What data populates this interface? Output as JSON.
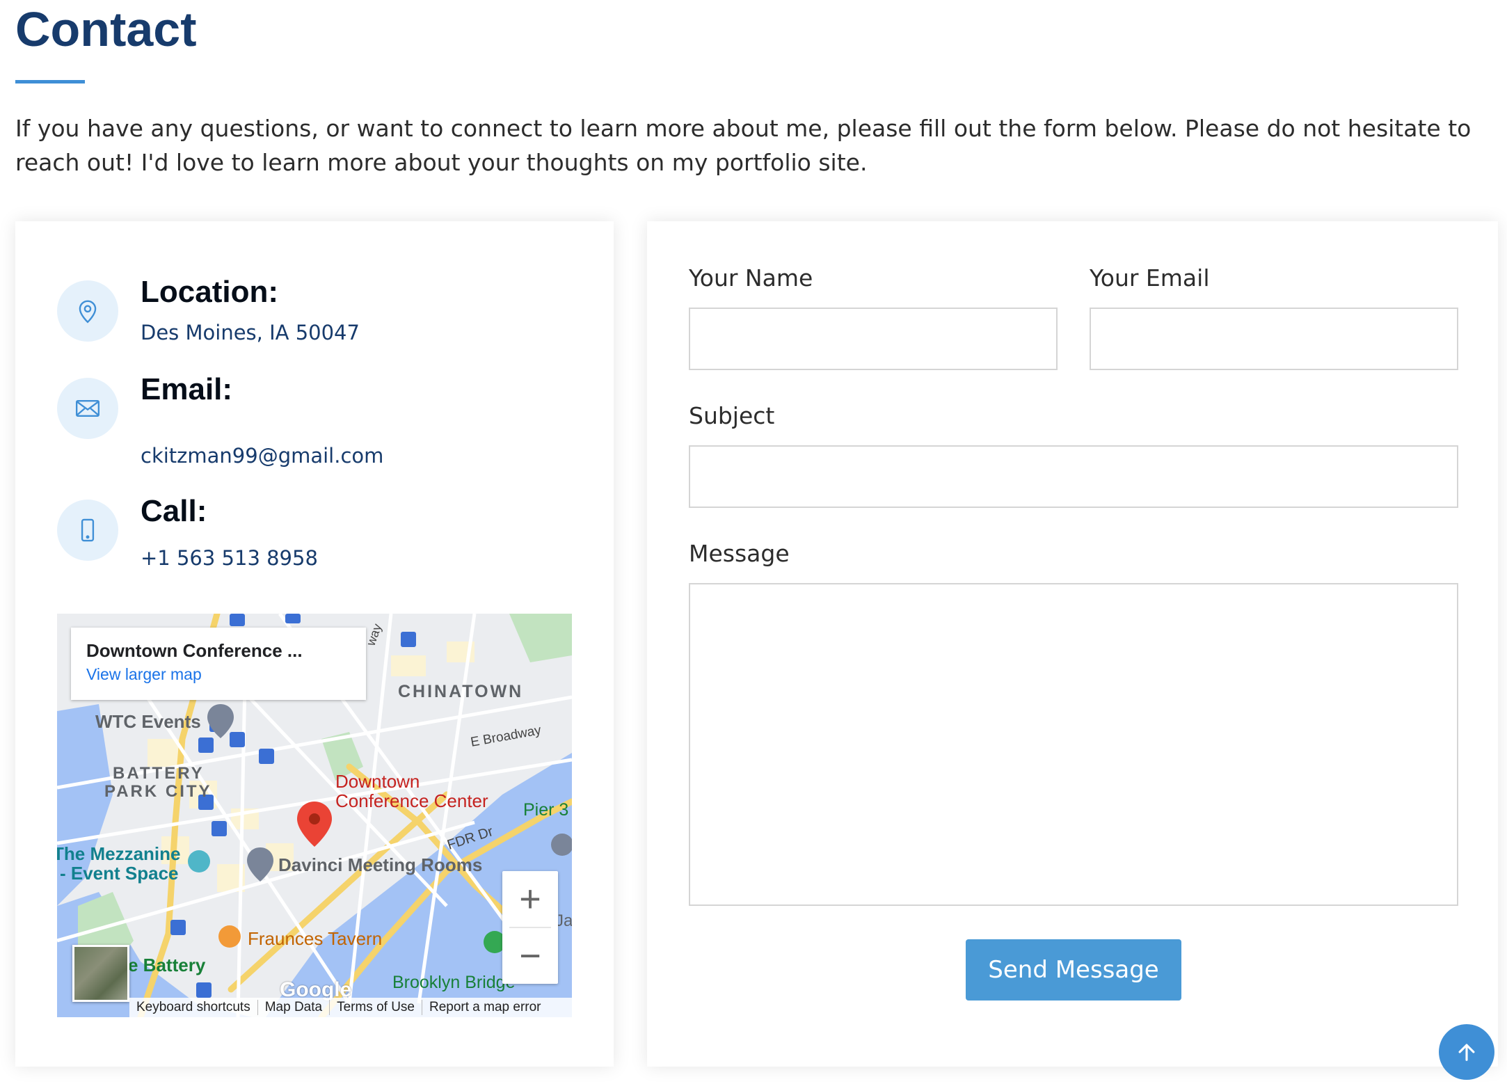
{
  "page": {
    "title": "Contact",
    "intro": "If you have any questions, or want to connect to learn more about me, please fill out the form below. Please do not hesitate to reach out! I'd love to learn more about your thoughts on my portfolio site."
  },
  "info": {
    "location_heading": "Location:",
    "location_value": "Des Moines, IA 50047",
    "email_heading": "Email:",
    "email_value": "ckitzman99@gmail.com",
    "call_heading": "Call:",
    "call_value": "+1 563 513 8958",
    "icons": [
      "map-pin-icon",
      "envelope-icon",
      "phone-icon"
    ],
    "icon_color": "#3f8fd6"
  },
  "map": {
    "card_title": "Downtown Conference ...",
    "card_link": "View larger map",
    "labels": {
      "chinatown": "CHINATOWN",
      "wtc": "WTC Events",
      "battery_1": "BATTERY",
      "battery_2": "PARK CITY",
      "broadway": "E Broadway",
      "downtown_1": "Downtown",
      "downtown_2": "Conference Center",
      "pier": "Pier 3",
      "fdr": "FDR Dr",
      "mezzanine_1": "The Mezzanine",
      "mezzanine_2": "- Event Space",
      "davinci": "Davinci Meeting Rooms",
      "fraunces": "Fraunces Tavern",
      "battery_park": "e Battery",
      "brooklyn": "Brooklyn Bridge",
      "road_way": "way",
      "ja": "Ja"
    },
    "google": "Google",
    "footer": [
      "Keyboard shortcuts",
      "Map Data",
      "Terms of Use",
      "Report a map error"
    ],
    "zoom_in": "+",
    "zoom_out": "−"
  },
  "form": {
    "name_label": "Your Name",
    "email_label": "Your Email",
    "subject_label": "Subject",
    "message_label": "Message",
    "send_label": "Send Message"
  },
  "colors": {
    "title": "#173b6c",
    "accent": "#3f8fd6",
    "button": "#4a9ad6"
  }
}
